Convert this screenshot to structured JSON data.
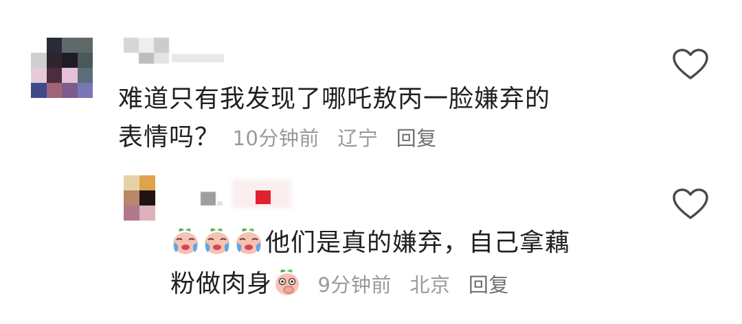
{
  "comments": [
    {
      "text_line1": "难道只有我发现了哪吒敖丙一脸嫌弃的",
      "text_line2": "表情吗？",
      "time": "10分钟前",
      "location": "辽宁",
      "reply_label": "回复"
    },
    {
      "text_line1": "他们是真的嫌弃，自己拿藕",
      "text_line2": "粉做肉身",
      "time": "9分钟前",
      "location": "北京",
      "reply_label": "回复"
    }
  ],
  "icons": {
    "like": "heart-outline-icon",
    "emoji": "crying-peach-emoji-icon",
    "emoji2": "thinking-peach-emoji-icon"
  },
  "colors": {
    "text": "#1f1f1f",
    "meta": "#9a9a9a",
    "heart_stroke": "#4a4a4a"
  }
}
